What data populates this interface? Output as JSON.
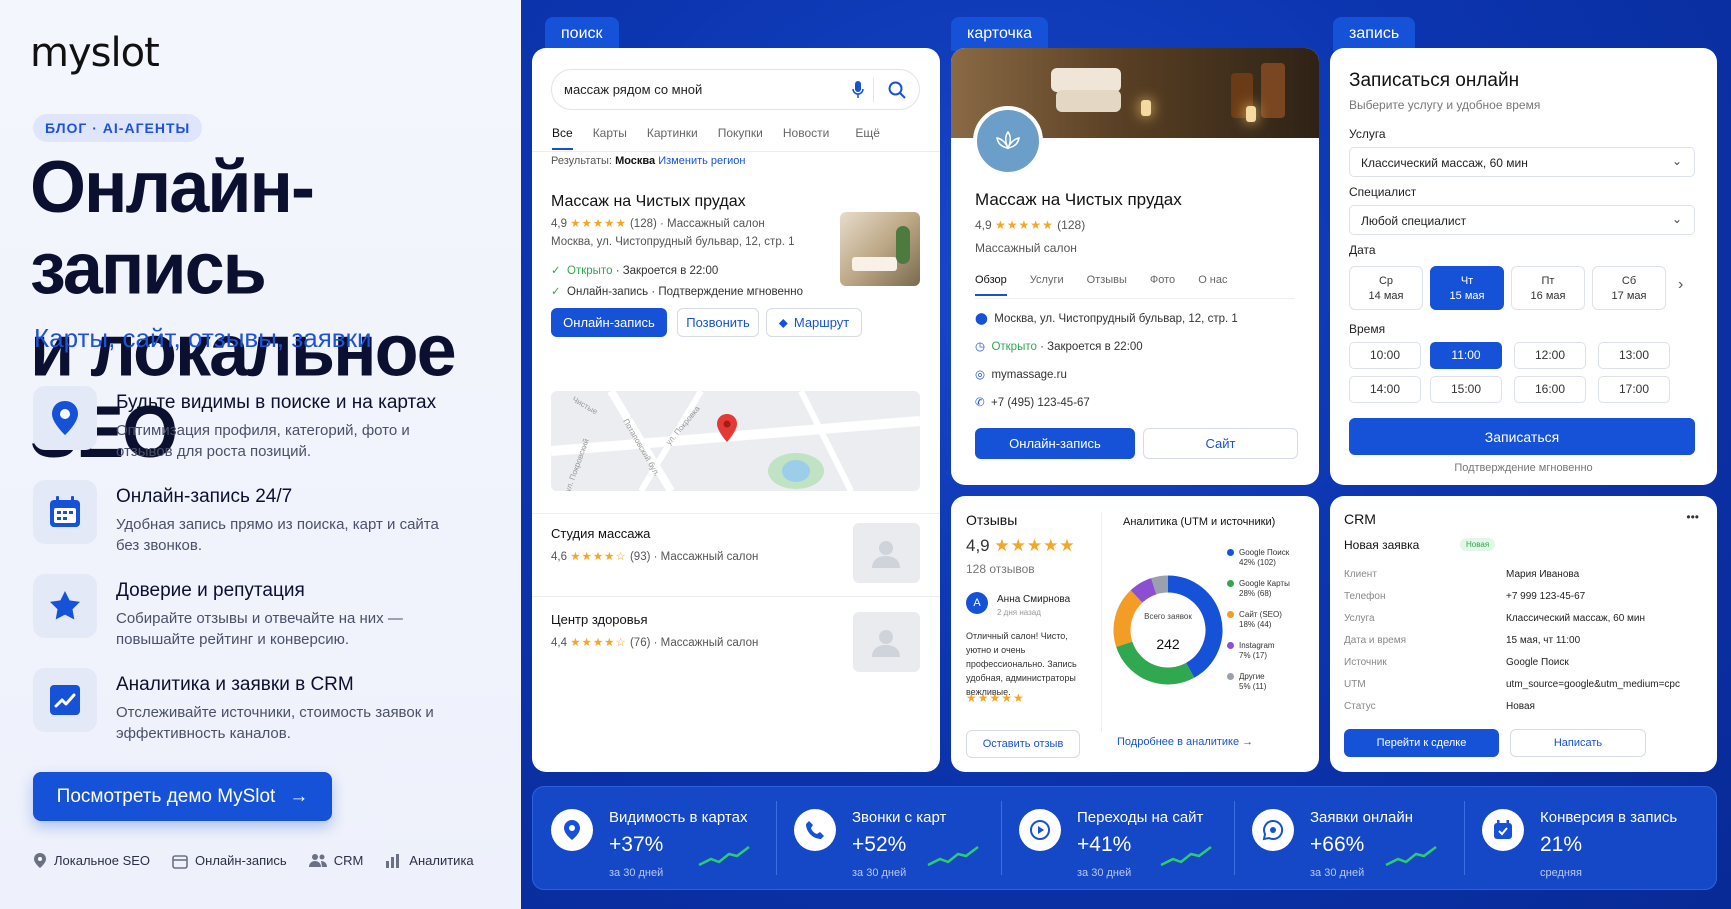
{
  "brand": {
    "logo": "myslot"
  },
  "hero": {
    "tag": "БЛОГ · AI-АГЕНТЫ",
    "title_line1": "Онлайн-запись",
    "title_line2": "и локальное SEO",
    "subtitle": "Карты, сайт, отзывы, заявки"
  },
  "features": [
    {
      "icon": "map-pin-icon",
      "title": "Будьте видимы в поиске и на картах",
      "desc": "Оптимизация профиля, категорий, фото и отзывов для роста позиций."
    },
    {
      "icon": "calendar-icon",
      "title": "Онлайн-запись 24/7",
      "desc": "Удобная запись прямо из поиска, карт и сайта без звонков."
    },
    {
      "icon": "star-icon",
      "title": "Доверие и репутация",
      "desc": "Собирайте отзывы и отвечайте на них — повышайте рейтинг и конверсию."
    },
    {
      "icon": "chart-icon",
      "title": "Аналитика и заявки в CRM",
      "desc": "Отслеживайте источники, стоимость заявок и эффективность каналов."
    }
  ],
  "cta": {
    "label": "Посмотреть демо MySlot",
    "arrow": "→"
  },
  "footer": [
    "Локальное SEO",
    "Онлайн-запись",
    "CRM",
    "Аналитика"
  ],
  "labels": {
    "search": "поиск",
    "card": "карточка",
    "booking": "запись"
  },
  "search": {
    "query": "массаж рядом со мной",
    "tabs": [
      "Все",
      "Карты",
      "Картинки",
      "Покупки",
      "Новости",
      "Ещё"
    ],
    "region_prefix": "Результаты:",
    "region": "Москва",
    "region_change": "Изменить регион",
    "result": {
      "title": "Массаж на Чистых прудах",
      "rating": "4,9",
      "stars": "★★★★★",
      "count": "(128)",
      "type": "· Массажный салон",
      "address": "Москва, ул. Чистопрудный бульвар, 12, стр. 1",
      "open": "Открыто",
      "closes": "· Закроется в 22:00",
      "booking": "Онлайн-запись",
      "confirm": "· Подтверждение мгновенно",
      "btn_book": "Онлайн-запись",
      "btn_call": "Позвонить",
      "btn_route": "Маршрут"
    },
    "map_streets": [
      "Чистые",
      "ул. Покровка",
      "Потаповский бул.",
      "ул. Покровский"
    ],
    "others": [
      {
        "title": "Студия массажа",
        "rating": "4,6",
        "stars": "★★★★☆",
        "count": "(93)",
        "type": "· Массажный салон"
      },
      {
        "title": "Центр здоровья",
        "rating": "4,4",
        "stars": "★★★★☆",
        "count": "(76)",
        "type": "· Массажный салон"
      }
    ]
  },
  "profile": {
    "title": "Массаж на Чистых прудах",
    "rating": "4,9",
    "stars": "★★★★★",
    "count": "(128)",
    "type": "Массажный салон",
    "tabs": [
      "Обзор",
      "Услуги",
      "Отзывы",
      "Фото",
      "О нас"
    ],
    "address": "Москва, ул. Чистопрудный бульвар, 12, стр. 1",
    "open": "Открыто",
    "closes": "· Закроется в 22:00",
    "site": "mymassage.ru",
    "phone": "+7 (495) 123-45-67",
    "btn_book": "Онлайн-запись",
    "btn_site": "Сайт"
  },
  "booking": {
    "title": "Записаться онлайн",
    "subtitle": "Выберите услугу и удобное время",
    "service_label": "Услуга",
    "service_value": "Классический массаж, 60 мин",
    "specialist_label": "Специалист",
    "specialist_value": "Любой специалист",
    "date_label": "Дата",
    "days": [
      {
        "d": "Ср",
        "n": "14 мая"
      },
      {
        "d": "Чт",
        "n": "15 мая"
      },
      {
        "d": "Пт",
        "n": "16 мая"
      },
      {
        "d": "Сб",
        "n": "17 мая"
      }
    ],
    "time_label": "Время",
    "times": [
      "10:00",
      "11:00",
      "12:00",
      "13:00",
      "14:00",
      "15:00",
      "16:00",
      "17:00"
    ],
    "btn": "Записаться",
    "note": "Подтверждение мгновенно"
  },
  "reviews": {
    "title": "Отзывы",
    "rating": "4,9",
    "stars": "★★★★★",
    "count": "128 отзывов",
    "author": "Анна Смирнова",
    "author_initial": "А",
    "when": "2 дня назад",
    "text": "Отличный салон! Чисто, уютно и очень профессионально. Запись удобная, администраторы вежливые.",
    "text_stars": "★★★★★",
    "btn": "Оставить отзыв"
  },
  "analytics": {
    "title": "Аналитика (UTM и источники)",
    "center_label": "Всего заявок",
    "center_value": "242",
    "link": "Подробнее в аналитике →",
    "colors": {
      "google_search": "#1552d8",
      "google_maps": "#2fa84f",
      "site": "#f39c26",
      "instagram": "#8b4fd1",
      "other": "#9aa0ad"
    }
  },
  "chart_data": {
    "type": "pie",
    "title": "Аналитика (UTM и источники)",
    "categories": [
      "Google Поиск",
      "Google Карты",
      "Сайт (SEO)",
      "Instagram",
      "Другие"
    ],
    "values": [
      42,
      28,
      18,
      7,
      5
    ],
    "counts": [
      102,
      68,
      44,
      17,
      11
    ],
    "labels": [
      "42% (102)",
      "28% (68)",
      "18% (44)",
      "7% (17)",
      "5% (11)"
    ]
  },
  "crm": {
    "title": "CRM",
    "menu": "•••",
    "subtitle": "Новая заявка",
    "badge": "Новая",
    "rows": [
      {
        "k": "Клиент",
        "v": "Мария Иванова"
      },
      {
        "k": "Телефон",
        "v": "+7 999 123-45-67"
      },
      {
        "k": "Услуга",
        "v": "Классический массаж, 60 мин"
      },
      {
        "k": "Дата и время",
        "v": "15 мая, чт 11:00"
      },
      {
        "k": "Источник",
        "v": "Google Поиск"
      },
      {
        "k": "UTM",
        "v": "utm_source=google&utm_medium=cpc"
      },
      {
        "k": "Статус",
        "v": "Новая"
      }
    ],
    "btn_deal": "Перейти к сделке",
    "btn_write": "Написать"
  },
  "stats": [
    {
      "title": "Видимость в картах",
      "value": "+37%",
      "period": "за 30 дней",
      "trend": true
    },
    {
      "title": "Звонки с карт",
      "value": "+52%",
      "period": "за 30 дней",
      "trend": true
    },
    {
      "title": "Переходы на сайт",
      "value": "+41%",
      "period": "за 30 дней",
      "trend": true
    },
    {
      "title": "Заявки онлайн",
      "value": "+66%",
      "period": "за 30 дней",
      "trend": true
    },
    {
      "title": "Конверсия в запись",
      "value": "21%",
      "period": "средняя",
      "trend": false
    }
  ]
}
